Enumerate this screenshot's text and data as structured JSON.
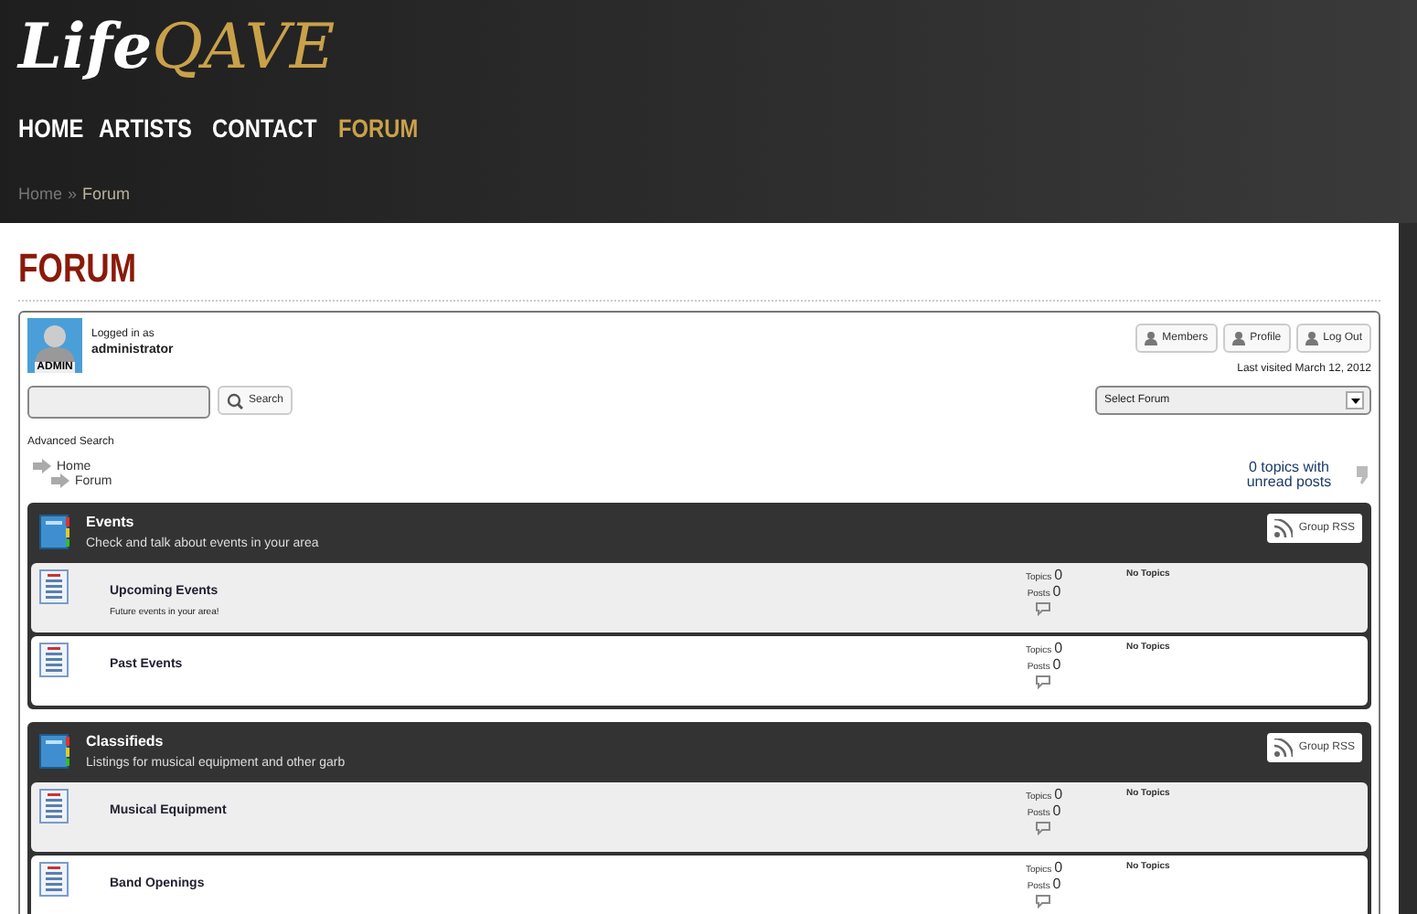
{
  "logo": {
    "first": "Life",
    "second": "QAVE"
  },
  "nav": [
    {
      "label": "HOME",
      "selected": false
    },
    {
      "label": "ARTISTS",
      "selected": false
    },
    {
      "label": "CONTACT",
      "selected": false
    },
    {
      "label": "FORUM",
      "selected": true
    }
  ],
  "breadcrumb": {
    "items": [
      "Home",
      "Forum"
    ],
    "separator": "»"
  },
  "page_title": "FORUM",
  "user": {
    "avatar_label": "ADMIN",
    "logged_in_as": "Logged in as",
    "name": "administrator",
    "buttons": [
      "Members",
      "Profile",
      "Log Out"
    ],
    "last_visited": "Last visited March 12, 2012"
  },
  "search": {
    "button": "Search",
    "advanced": "Advanced Search"
  },
  "forum_select": {
    "value": "Select Forum"
  },
  "tree": [
    {
      "label": "Home",
      "children": [
        {
          "label": "Forum"
        }
      ]
    }
  ],
  "unread": "0 topics with unread posts",
  "groups": [
    {
      "title": "Events",
      "description": "Check and talk about events in your area",
      "rss": "Group RSS",
      "forums": [
        {
          "name": "Upcoming Events",
          "description": "Future events in your area!",
          "topics_label": "Topics",
          "topics": "0",
          "posts_label": "Posts",
          "posts": "0",
          "last": "No Topics"
        },
        {
          "name": "Past Events",
          "topics_label": "Topics",
          "topics": "0",
          "posts_label": "Posts",
          "posts": "0",
          "last": "No Topics"
        }
      ]
    },
    {
      "title": "Classifieds",
      "description": "Listings for musical equipment and other garb",
      "rss": "Group RSS",
      "forums": [
        {
          "name": "Musical Equipment",
          "topics_label": "Topics",
          "topics": "0",
          "posts_label": "Posts",
          "posts": "0",
          "last": "No Topics"
        },
        {
          "name": "Band Openings",
          "topics_label": "Topics",
          "topics": "0",
          "posts_label": "Posts",
          "posts": "0",
          "last": "No Topics"
        }
      ]
    }
  ]
}
